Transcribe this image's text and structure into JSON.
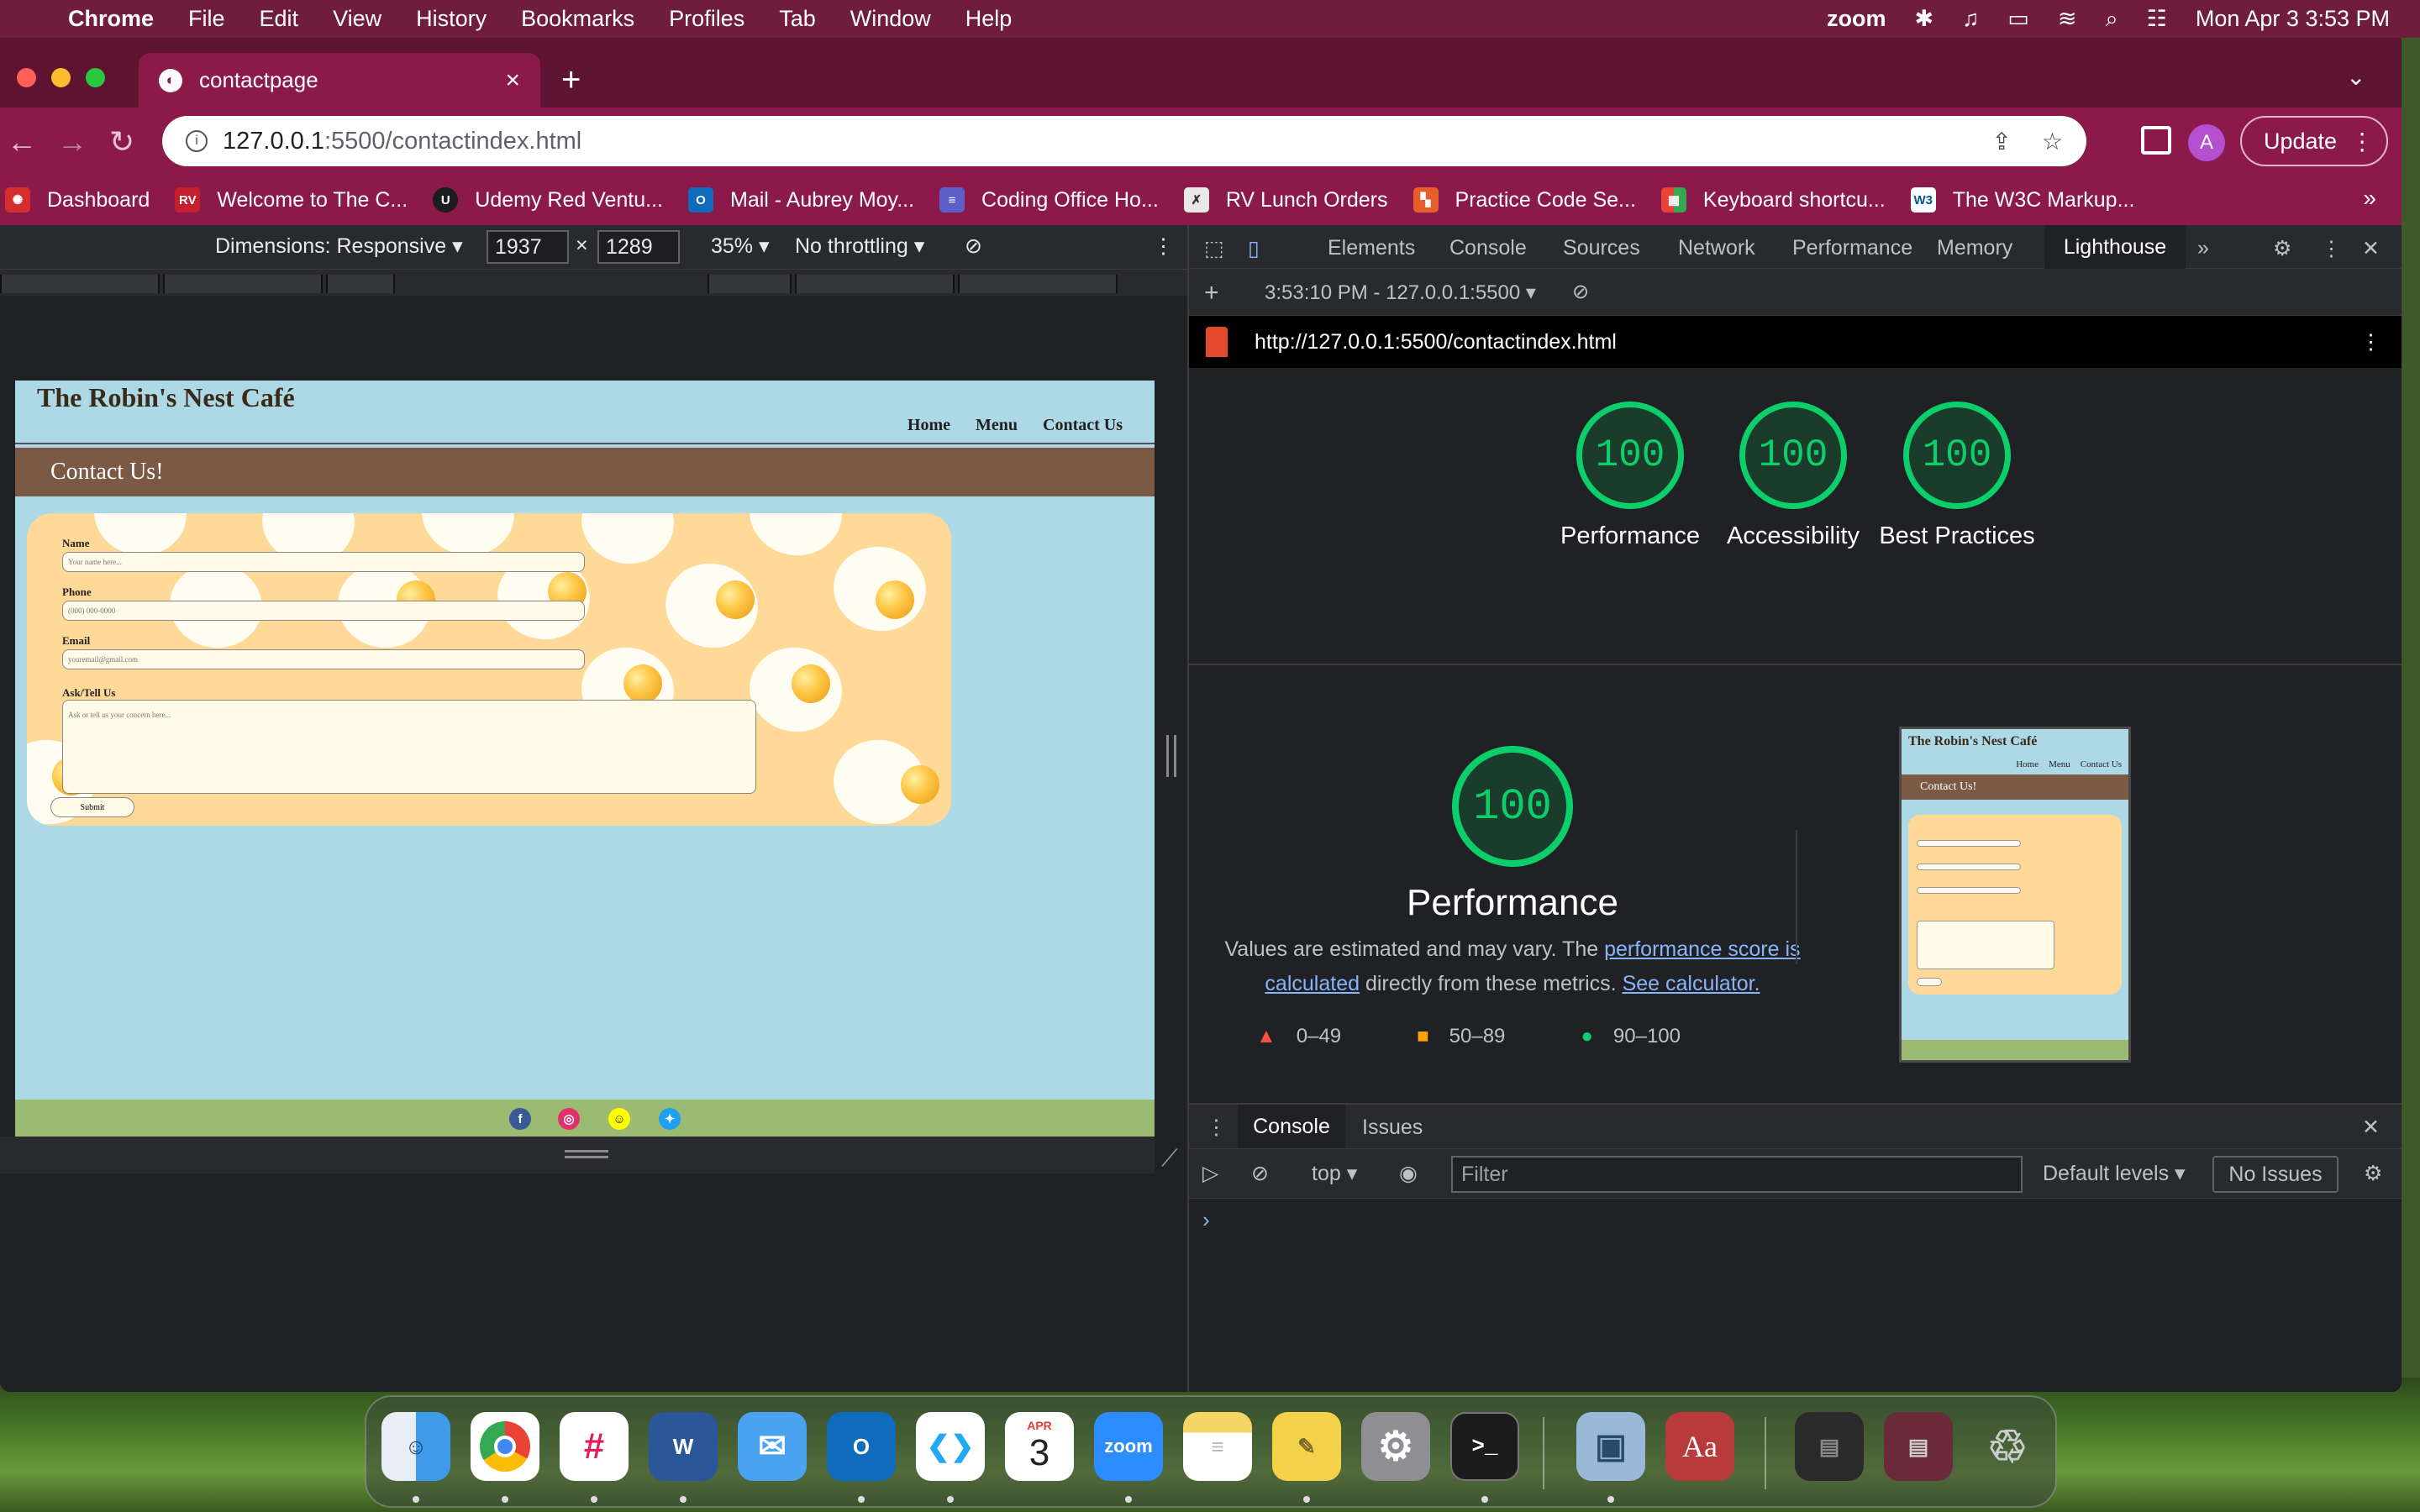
{
  "menubar": {
    "apple": "",
    "app_name": "Chrome",
    "items": [
      "File",
      "Edit",
      "View",
      "History",
      "Bookmarks",
      "Profiles",
      "Tab",
      "Window",
      "Help"
    ],
    "zoom": "zoom",
    "datetime": "Mon Apr 3  3:53 PM"
  },
  "browser": {
    "tab_title": "contactpage",
    "url_host": "127.0.0.1",
    "url_rest": ":5500/contactindex.html",
    "update_label": "Update",
    "avatar_letter": "A",
    "bookmarks": [
      {
        "label": "Dashboard",
        "color": "#d62e2e",
        "glyph": "✺"
      },
      {
        "label": "Welcome to The C...",
        "color": "#c41f2f",
        "glyph": "RV"
      },
      {
        "label": "Udemy Red Ventu...",
        "color": "#1c1d1f",
        "glyph": "U"
      },
      {
        "label": "Mail - Aubrey Moy...",
        "color": "#0f6cbd",
        "glyph": "O"
      },
      {
        "label": "Coding Office Ho...",
        "color": "#5b5fc7",
        "glyph": "≡"
      },
      {
        "label": "RV Lunch Orders",
        "color": "#e8e8e8",
        "glyph": "✗"
      },
      {
        "label": "Practice Code Se...",
        "color": "#e85d2a",
        "glyph": "▚"
      },
      {
        "label": "Keyboard shortcu...",
        "color": "#4285f4",
        "glyph": "▦"
      },
      {
        "label": "The W3C Markup...",
        "color": "#005a9c",
        "glyph": "W3"
      }
    ]
  },
  "device_toolbar": {
    "dimensions_label": "Dimensions: Responsive",
    "width": "1937",
    "height": "1289",
    "zoom": "35%",
    "throttling": "No throttling"
  },
  "site": {
    "title": "The Robin's Nest Café",
    "nav": [
      "Home",
      "Menu",
      "Contact Us"
    ],
    "banner": "Contact Us!",
    "form": {
      "name_label": "Name",
      "name_placeholder": "Your name here...",
      "phone_label": "Phone",
      "phone_placeholder": "(000) 000-0000",
      "email_label": "Email",
      "email_placeholder": "youremail@gmail.com",
      "ask_label": "Ask/Tell Us",
      "ask_placeholder": "Ask or tell us your concern here...",
      "submit_label": "Submit"
    }
  },
  "devtools": {
    "tabs": [
      "Elements",
      "Console",
      "Sources",
      "Network",
      "Performance",
      "Memory",
      "Lighthouse"
    ],
    "report_time": "3:53:10 PM - 127.0.0.1:5500",
    "report_url": "http://127.0.0.1:5500/contactindex.html",
    "scores": [
      {
        "label": "Performance",
        "value": "100"
      },
      {
        "label": "Accessibility",
        "value": "100"
      },
      {
        "label": "Best Practices",
        "value": "100"
      }
    ],
    "perf_score": "100",
    "perf_title": "Performance",
    "perf_desc_1": "Values are estimated and may vary. The ",
    "perf_link_1": "performance score is calculated",
    "perf_desc_2": " directly from these metrics. ",
    "perf_link_2": "See calculator.",
    "legend": [
      "0–49",
      "50–89",
      "90–100"
    ],
    "thumb": {
      "title": "The Robin's Nest Café",
      "nav": [
        "Home",
        "Menu",
        "Contact Us"
      ],
      "banner": "Contact Us!"
    },
    "drawer_tabs": [
      "Console",
      "Issues"
    ],
    "context": "top",
    "filter_placeholder": "Filter",
    "levels": "Default levels",
    "issues": "No Issues",
    "prompt": "›"
  },
  "dock": {
    "apps": [
      {
        "name": "finder",
        "color": "#3d9be9",
        "glyph": "☺"
      },
      {
        "name": "chrome",
        "color": "#ffffff",
        "glyph": "●"
      },
      {
        "name": "slack",
        "color": "#ffffff",
        "glyph": "#"
      },
      {
        "name": "word",
        "color": "#2b579a",
        "glyph": "W"
      },
      {
        "name": "mail",
        "color": "#4aa3f0",
        "glyph": "✉"
      },
      {
        "name": "outlook",
        "color": "#0f6cbd",
        "glyph": "O"
      },
      {
        "name": "vscode",
        "color": "#23a9f2",
        "glyph": "❮❯"
      },
      {
        "name": "calendar",
        "color": "#ffffff",
        "glyph": "3"
      },
      {
        "name": "zoom",
        "color": "#2d8cff",
        "glyph": "zoom"
      },
      {
        "name": "notes",
        "color": "#f5d565",
        "glyph": "≡"
      },
      {
        "name": "stickies",
        "color": "#f3d24a",
        "glyph": "✎"
      },
      {
        "name": "system-preferences",
        "color": "#8e8e93",
        "glyph": "⚙"
      },
      {
        "name": "terminal",
        "color": "#1c1c1c",
        "glyph": ">_"
      },
      {
        "name": "preview",
        "color": "#9ab8d8",
        "glyph": "▣"
      },
      {
        "name": "dictionary",
        "color": "#b83a3a",
        "glyph": "Aa"
      },
      {
        "name": "recent-1",
        "color": "#2a2a2a",
        "glyph": "▤"
      },
      {
        "name": "recent-2",
        "color": "#6a2a3a",
        "glyph": "▤"
      },
      {
        "name": "trash",
        "color": "#c9c9c9",
        "glyph": "🗑"
      }
    ],
    "calendar_month": "APR"
  }
}
